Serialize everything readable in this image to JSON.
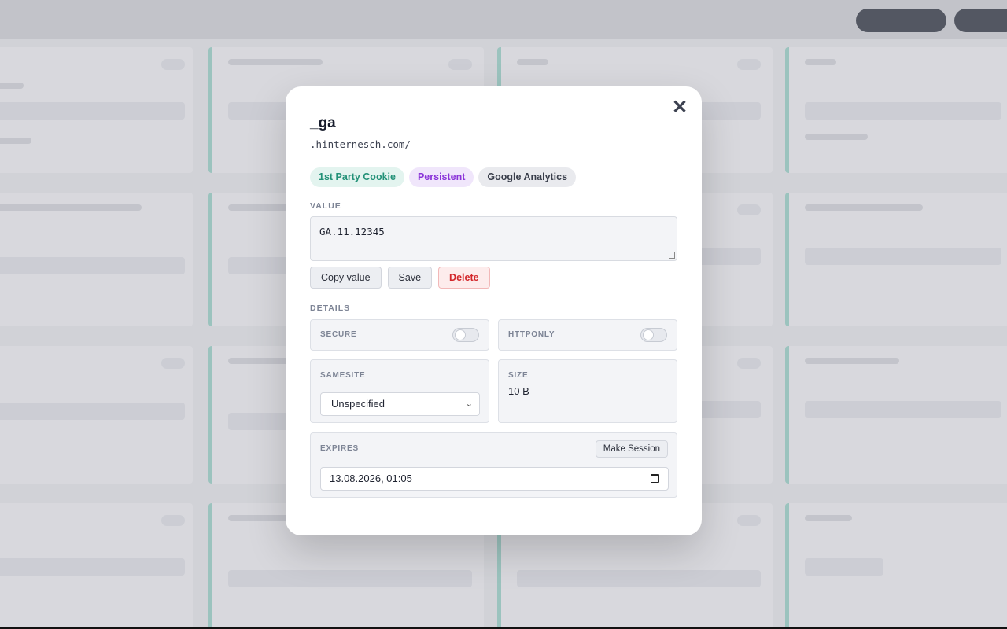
{
  "cookie": {
    "name": "_ga",
    "domain": ".hinternesch.com/",
    "badges": {
      "party": "1st Party Cookie",
      "persistence": "Persistent",
      "category": "Google Analytics"
    },
    "value_label": "VALUE",
    "value": "GA.11.12345",
    "actions": {
      "copy": "Copy value",
      "save": "Save",
      "delete": "Delete"
    },
    "details_label": "DETAILS",
    "secure": {
      "label": "SECURE",
      "checked": false
    },
    "httponly": {
      "label": "HTTPONLY",
      "checked": false
    },
    "samesite": {
      "label": "SAMESITE",
      "value": "Unspecified"
    },
    "size": {
      "label": "SIZE",
      "value": "10 B"
    },
    "expires": {
      "label": "EXPIRES",
      "make_session_label": "Make Session",
      "value": "13.08.2026, 01:05"
    }
  },
  "close_icon": "close-icon",
  "colors": {
    "party_badge": "#229177",
    "persistent_badge": "#8a33d8",
    "delete": "#d3262a",
    "card_accent": "#8fc5bb"
  }
}
